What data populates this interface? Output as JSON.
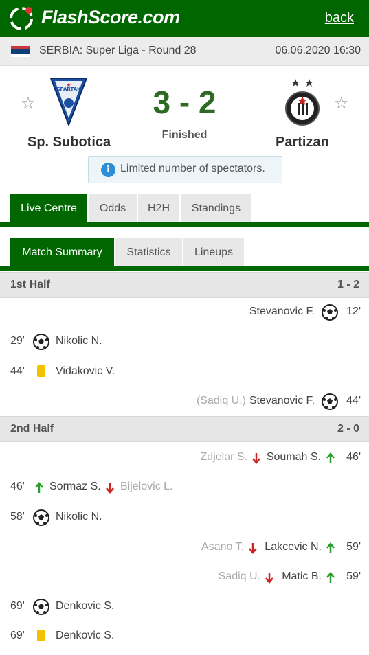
{
  "app": {
    "logo_text": "FlashScore.com",
    "back_label": "back"
  },
  "league": {
    "name": "SERBIA: Super Liga - Round 28",
    "datetime": "06.06.2020 16:30"
  },
  "match": {
    "home": {
      "name": "Sp. Subotica",
      "crest_text": "SPARTAK"
    },
    "away": {
      "name": "Partizan"
    },
    "score": "3 - 2",
    "status": "Finished",
    "info": "Limited number of spectators.",
    "info_icon_glyph": "i"
  },
  "tabs": [
    "Live Centre",
    "Odds",
    "H2H",
    "Standings"
  ],
  "subtabs": [
    "Match Summary",
    "Statistics",
    "Lineups"
  ],
  "periods": [
    {
      "label": "1st Half",
      "score": "1 - 2",
      "events": [
        {
          "side": "away",
          "time": "12'",
          "type": "goal",
          "player": "Stevanovic F."
        },
        {
          "side": "home",
          "time": "29'",
          "type": "goal",
          "player": "Nikolic N."
        },
        {
          "side": "home",
          "time": "44'",
          "type": "yellow-card",
          "player": "Vidakovic V."
        },
        {
          "side": "away",
          "time": "44'",
          "type": "goal",
          "player": "Stevanovic F.",
          "assist": "(Sadiq U.)"
        }
      ]
    },
    {
      "label": "2nd Half",
      "score": "2 - 0",
      "events": [
        {
          "side": "away",
          "time": "46'",
          "type": "substitution",
          "player_in": "Soumah S.",
          "player_out": "Zdjelar S."
        },
        {
          "side": "home",
          "time": "46'",
          "type": "substitution",
          "player_in": "Sormaz S.",
          "player_out": "Bijelovic L."
        },
        {
          "side": "home",
          "time": "58'",
          "type": "goal",
          "player": "Nikolic N."
        },
        {
          "side": "away",
          "time": "59'",
          "type": "substitution",
          "player_in": "Lakcevic N.",
          "player_out": "Asano T."
        },
        {
          "side": "away",
          "time": "59'",
          "type": "substitution",
          "player_in": "Matic B.",
          "player_out": "Sadiq U."
        },
        {
          "side": "home",
          "time": "69'",
          "type": "goal",
          "player": "Denkovic S."
        },
        {
          "side": "home",
          "time": "69'",
          "type": "yellow-card",
          "player": "Denkovic S."
        }
      ]
    }
  ],
  "colors": {
    "brand_green": "#006600",
    "score_green": "#2d6b22",
    "card_yellow": "#f2c200",
    "sub_in_green": "#2a9d2a",
    "sub_out_red": "#cc2222"
  }
}
